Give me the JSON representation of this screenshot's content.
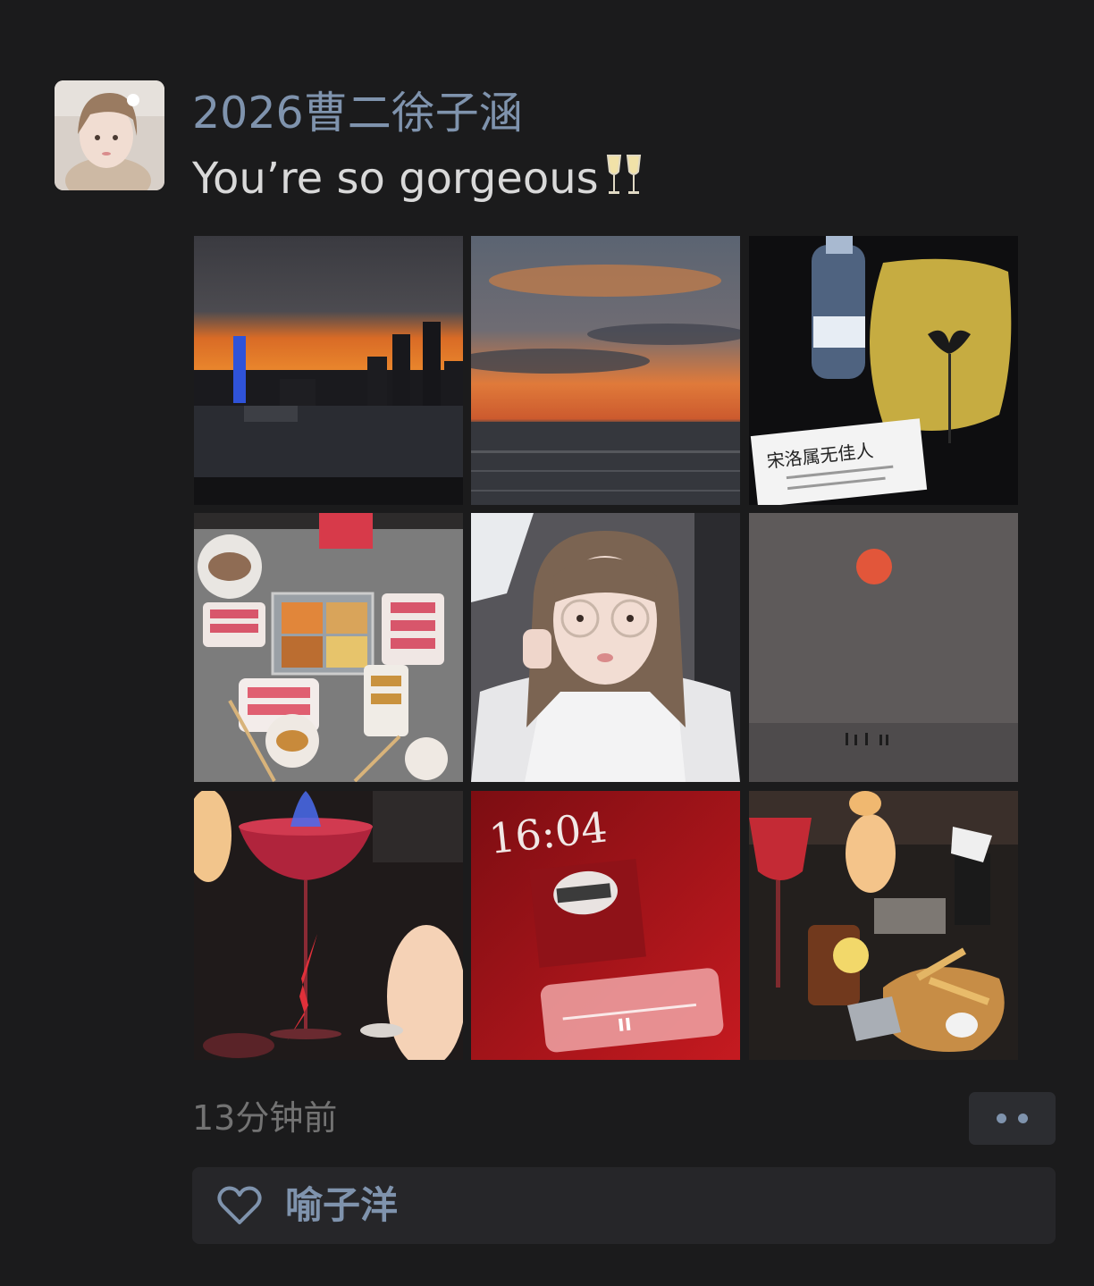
{
  "post": {
    "author_name": "2026曹二徐子涵",
    "text": "You’re so gorgeous",
    "text_emoji": "champagne-glasses-icon",
    "timestamp": "13分钟前"
  },
  "photos": [
    {
      "subject": "city skyline at sunset"
    },
    {
      "subject": "sunset over the sea"
    },
    {
      "subject": "cocktail glass with bottle and card"
    },
    {
      "subject": "hotpot table spread"
    },
    {
      "subject": "selfie in a car"
    },
    {
      "subject": "red sun over beach"
    },
    {
      "subject": "flaming red cocktail"
    },
    {
      "subject": "phone lock screen with music player"
    },
    {
      "subject": "bar table with drinks and snacks"
    }
  ],
  "photo_texts": {
    "card_title": "宋洛属无佳人",
    "lock_time": "16:04"
  },
  "likes": {
    "names": "喻子洋"
  },
  "colors": {
    "background": "#1b1b1c",
    "name_link": "#7f93ad",
    "body_text": "#d9d9d9",
    "muted_text": "#737373",
    "like_bar": "#262629",
    "more_button": "#2c2d31"
  }
}
